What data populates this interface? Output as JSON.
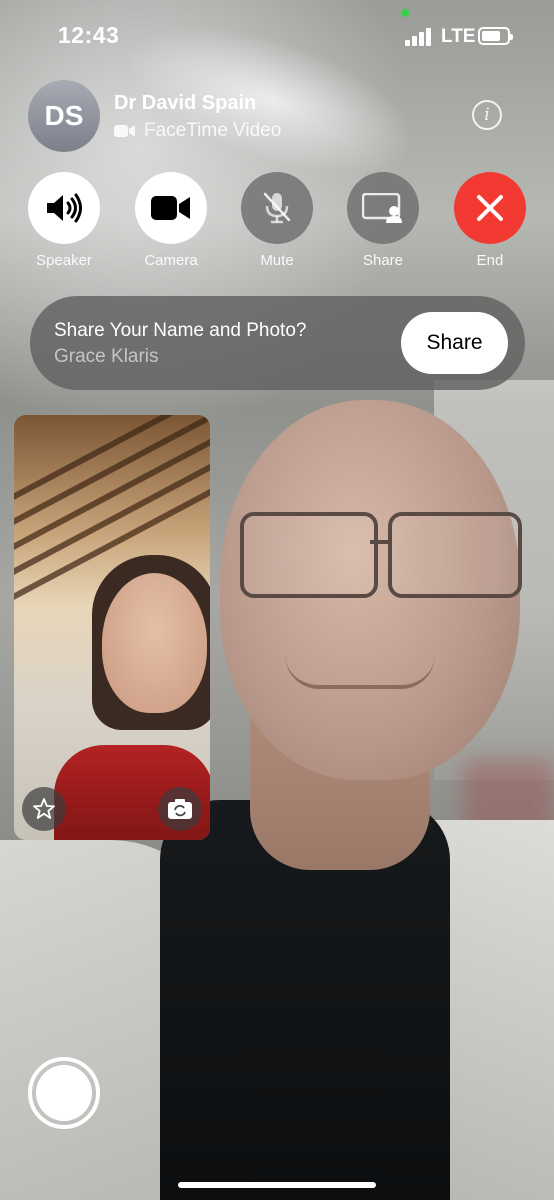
{
  "status_bar": {
    "time": "12:43",
    "network": "LTE",
    "signal_icon": "cellular-signal-icon",
    "battery_icon": "battery-icon",
    "camera_indicator_color": "#33d04a"
  },
  "call": {
    "avatar_initials": "DS",
    "caller_name": "Dr David Spain",
    "call_type": "FaceTime Video",
    "call_type_icon": "video-camera-icon",
    "info_icon": "info-icon"
  },
  "controls": [
    {
      "label": "Speaker",
      "icon": "speaker-icon"
    },
    {
      "label": "Camera",
      "icon": "video-camera-icon"
    },
    {
      "label": "Mute",
      "icon": "mic-muted-icon"
    },
    {
      "label": "Share",
      "icon": "screen-share-icon"
    },
    {
      "label": "End",
      "icon": "close-icon"
    }
  ],
  "share_banner": {
    "title": "Share Your Name and Photo?",
    "name": "Grace Klaris",
    "button_label": "Share"
  },
  "self_view": {
    "effects_icon": "effects-star-icon",
    "flip_icon": "camera-flip-icon"
  },
  "colors": {
    "end_button": "#f23a32",
    "button_white": "#ffffff",
    "button_grey": "#6e6e6e"
  }
}
